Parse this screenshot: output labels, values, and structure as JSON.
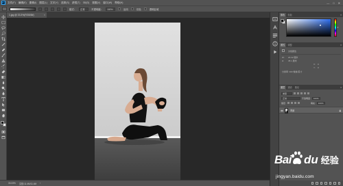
{
  "app": {
    "logo_text": "Ps",
    "window_controls": [
      "—",
      "□",
      "✕"
    ]
  },
  "menubar": {
    "items": [
      "文件(F)",
      "编辑(E)",
      "图像(I)",
      "图层(L)",
      "文字(Y)",
      "选择(S)",
      "滤镜(T)",
      "3D(D)",
      "视图(V)",
      "窗口(W)",
      "帮助(H)"
    ]
  },
  "options_bar": {
    "mode_label": "模式：",
    "mode_value": "正常",
    "opacity_label": "不透明度：",
    "opacity_value": "100%",
    "reverse_label": "反向",
    "dither_label": "仿色",
    "transparency_label": "透明区域"
  },
  "document_tab": {
    "title": "1.jpg @ 33.3%(RGB/8#)",
    "close_symbol": "×"
  },
  "status_bar": {
    "zoom": "33.33%",
    "doc_info": "文档:11.4M/11.4M",
    "arrow": "›"
  },
  "color_panel": {
    "tabs": [
      "颜色",
      "色板"
    ],
    "active_tab": 0,
    "menu_symbol": "≡",
    "foreground": "#111111",
    "background": "#f4f4f4",
    "hue_color": "#2e6ff0"
  },
  "properties_panel": {
    "tabs": [
      "属性",
      "调整"
    ],
    "active_tab": 0,
    "menu_symbol": "≡",
    "title": "文档属性",
    "rows": [
      {
        "label": "W:",
        "value": "20.32 厘米"
      },
      {
        "label": "H:",
        "value": "38.1 厘米"
      },
      {
        "label": "X:",
        "value": "0"
      },
      {
        "label": "Y:",
        "value": "0"
      }
    ],
    "resolution": "分辨率: 300 像素/英寸"
  },
  "layers_panel": {
    "tabs": [
      "图层",
      "通道",
      "路径"
    ],
    "active_tab": 0,
    "menu_symbol": "≡",
    "kind_label": "类型",
    "blend_mode": "正常",
    "opacity_label": "不透明度:",
    "opacity_value": "100%",
    "lock_label": "锁定:",
    "fill_label": "填充:",
    "fill_value": "100%",
    "layer": {
      "name": "背景"
    }
  },
  "watermark": {
    "brand_left": "Bai",
    "brand_right": "du",
    "brand_cn": "经验",
    "url": "jingyan.baidu.com"
  },
  "tools": [
    "move-tool",
    "marquee-tool",
    "lasso-tool",
    "quick-select-tool",
    "crop-tool",
    "eyedropper-tool",
    "healing-brush-tool",
    "brush-tool",
    "clone-stamp-tool",
    "history-brush-tool",
    "eraser-tool",
    "gradient-tool",
    "blur-tool",
    "dodge-tool",
    "pen-tool",
    "type-tool",
    "path-select-tool",
    "rectangle-tool",
    "hand-tool",
    "zoom-tool"
  ]
}
